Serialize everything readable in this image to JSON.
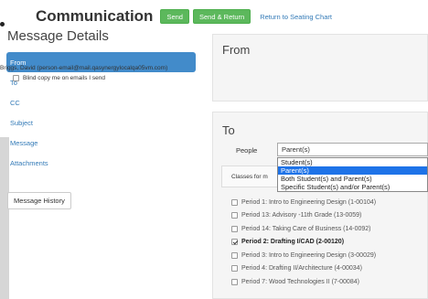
{
  "header": {
    "title": "Communication",
    "send_label": "Send",
    "send_return_label": "Send & Return",
    "return_link": "Return to Seating Chart"
  },
  "section_title": "Message Details",
  "sidebar": {
    "items": [
      {
        "label": "From",
        "active": true
      },
      {
        "label": "To",
        "active": false
      },
      {
        "label": "CC",
        "active": false
      },
      {
        "label": "Subject",
        "active": false
      },
      {
        "label": "Message",
        "active": false
      },
      {
        "label": "Attachments",
        "active": false
      }
    ],
    "history_button": "Message History"
  },
  "from": {
    "heading": "From",
    "sender": "Briggs, David (person-email@mail.qasynergylocalqa05vm.com)",
    "bcc_label": "Blind copy me on emails I send"
  },
  "to": {
    "heading": "To",
    "people_label": "People",
    "people_selected": "Parent(s)",
    "options": [
      "Student(s)",
      "Parent(s)",
      "Both Student(s) and Parent(s)",
      "Specific Student(s) and/or Parent(s)"
    ],
    "selected_option_index": 1,
    "classes_label": "Classes for m",
    "classes": [
      {
        "label": "Period 1: Intro to Engineering Design (1-00104)",
        "checked": false
      },
      {
        "label": "Period 13: Advisory -11th Grade (13-0059)",
        "checked": false
      },
      {
        "label": "Period 14: Taking Care of Business (14-0092)",
        "checked": false
      },
      {
        "label": "Period 2: Drafting I/CAD (2-00120)",
        "checked": true
      },
      {
        "label": "Period 3: Intro to Engineering Design (3-00029)",
        "checked": false
      },
      {
        "label": "Period 4: Drafting II/Architecture (4-00034)",
        "checked": false
      },
      {
        "label": "Period 7: Wood Technologies II (7-00084)",
        "checked": false
      }
    ]
  },
  "colors": {
    "accent": "#428bca",
    "send_green": "#5cb85c",
    "dropdown_highlight": "#1e73e8"
  }
}
